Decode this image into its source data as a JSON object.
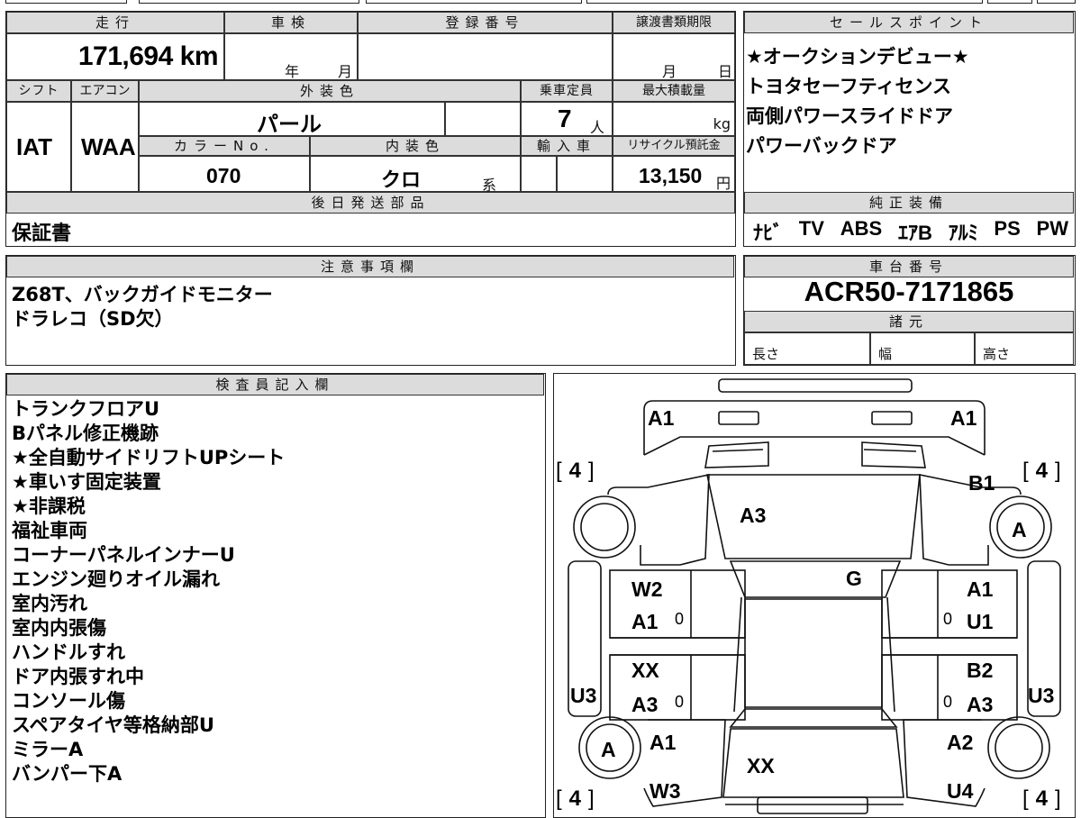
{
  "header": {
    "mileage_label": "走行",
    "inspection_label": "車検",
    "registration_label": "登録番号",
    "transfer_label": "譲渡書類期限",
    "mileage_value": "171,694 km",
    "inspection_year": "年",
    "inspection_month": "月",
    "transfer_month": "月",
    "transfer_day": "日",
    "shift_label": "シフト",
    "ac_label": "エアコン",
    "exterior_label": "外装色",
    "seating_label": "乗車定員",
    "maxload_label": "最大積載量",
    "shift_value": "IAT",
    "ac_value": "WAA",
    "exterior_value": "パール",
    "seating_value": "7",
    "seating_unit": "人",
    "maxload_unit": "kg",
    "color_no_label": "カラーNo.",
    "interior_label": "内装色",
    "import_label": "輸入車",
    "recycle_label": "リサイクル預託金",
    "color_no_value": "070",
    "interior_value": "クロ",
    "interior_suffix": "系",
    "recycle_value": "13,150",
    "recycle_unit": "円",
    "later_parts_label": "後日発送部品",
    "later_parts_value": "保証書"
  },
  "sales": {
    "label": "セールスポイント",
    "lines": [
      "★オークションデビュー★",
      "トヨタセーフティセンス",
      "両側パワースライドドア",
      "パワーバックドア"
    ]
  },
  "equipment": {
    "label": "純正装備",
    "items": [
      "ﾅﾋﾞ",
      "TV",
      "ABS",
      "ｴｱB",
      "ｱﾙﾐ",
      "PS",
      "PW"
    ]
  },
  "caution": {
    "label": "注意事項欄",
    "lines": [
      "Z68T、バックガイドモニター",
      "ドラレコ（SD欠）"
    ]
  },
  "chassis": {
    "label": "車台番号",
    "value": "ACR50-7171865",
    "specs_label": "諸元",
    "length_label": "長さ",
    "width_label": "幅",
    "height_label": "高さ"
  },
  "inspector": {
    "label": "検査員記入欄",
    "lines": [
      "トランクフロアU",
      "Bパネル修正機跡",
      "★全自動サイドリフトUPシート",
      "★車いす固定装置",
      "★非課税",
      "福祉車両",
      "コーナーパネルインナーU",
      "エンジン廻りオイル漏れ",
      "室内汚れ",
      "室内内張傷",
      "ハンドルすれ",
      "ドア内張すれ中",
      "コンソール傷",
      "スペアタイヤ等格納部U",
      "ミラーA",
      "バンパー下A"
    ]
  },
  "diagram": {
    "front_left": "A1",
    "front_right": "A1",
    "tire_fl": "4",
    "tire_fr": "4",
    "tire_rl": "4",
    "tire_rr": "4",
    "b1": "B1",
    "wheel_right_front": "A",
    "hood": "A3",
    "roof": "G",
    "left_front_door_1": "W2",
    "left_front_door_2": "A1",
    "left_front_zero": "0",
    "right_front_door_1": "A1",
    "right_front_door_2": "U1",
    "right_front_zero": "0",
    "left_rear_door_1": "XX",
    "left_rear_door_2": "A3",
    "left_rear_zero": "0",
    "right_rear_door_1": "B2",
    "right_rear_door_2": "A3",
    "right_rear_zero": "0",
    "left_sill": "U3",
    "right_sill": "U3",
    "wheel_left_rear": "A",
    "left_rear_q1": "A1",
    "left_rear_q2": "W3",
    "right_rear_q1": "A2",
    "right_rear_q2": "U4",
    "rear": "XX"
  }
}
